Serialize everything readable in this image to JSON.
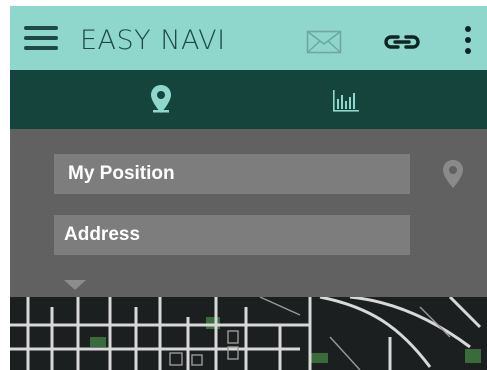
{
  "app": {
    "title": "EASY NAVI"
  },
  "colors": {
    "appbar": "#8fd6cd",
    "tabbar": "#14443b",
    "accent_icon": "#8fd6cd",
    "panel": "#616161",
    "field": "#7d7d7d",
    "map_background": "#1c1f1f"
  },
  "appbar": {
    "icons": [
      "menu-icon",
      "mail-icon",
      "link-icon",
      "more-vert-icon"
    ]
  },
  "tabs": [
    {
      "icon": "location-pin-icon",
      "selected": true
    },
    {
      "icon": "bar-chart-icon",
      "selected": false
    }
  ],
  "form": {
    "position_label": "My Position",
    "address_label": "Address"
  }
}
